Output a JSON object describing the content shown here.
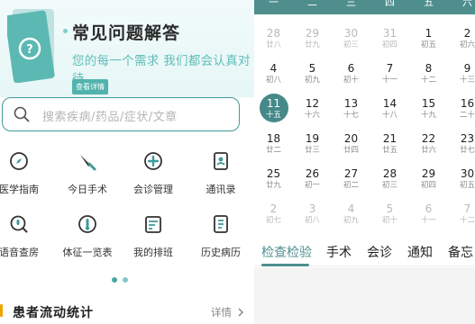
{
  "banner": {
    "title": "常见问题解答",
    "subtitle": "您的每一个需求 我们都会认真对待",
    "button": "查看详情"
  },
  "search": {
    "placeholder": "搜索疾病/药品/症状/文章"
  },
  "grid": [
    {
      "label": "医学指南",
      "icon": "compass-icon"
    },
    {
      "label": "今日手术",
      "icon": "scalpel-icon"
    },
    {
      "label": "会诊管理",
      "icon": "medical-cross-icon"
    },
    {
      "label": "通讯录",
      "icon": "contacts-icon"
    },
    {
      "label": "语音查房",
      "icon": "voice-search-icon"
    },
    {
      "label": "体征一览表",
      "icon": "thermometer-icon"
    },
    {
      "label": "我的排班",
      "icon": "schedule-icon"
    },
    {
      "label": "历史病历",
      "icon": "history-record-icon"
    }
  ],
  "pager": {
    "pages": 2,
    "active": 1
  },
  "stats": {
    "title": "患者流动统计",
    "more": "详情"
  },
  "calendar": {
    "weekdays": [
      "一",
      "二",
      "三",
      "四",
      "五",
      "六"
    ],
    "weeks": [
      [
        [
          "28",
          "廿八",
          true
        ],
        [
          "29",
          "廿九",
          true
        ],
        [
          "30",
          "初三",
          true
        ],
        [
          "31",
          "初四",
          true
        ],
        [
          "1",
          "初五",
          false
        ],
        [
          "2",
          "初六",
          false
        ]
      ],
      [
        [
          "4",
          "初八",
          false
        ],
        [
          "5",
          "初九",
          false
        ],
        [
          "6",
          "初十",
          false
        ],
        [
          "7",
          "十一",
          false
        ],
        [
          "8",
          "十二",
          false
        ],
        [
          "9",
          "十三",
          false
        ]
      ],
      [
        [
          "11",
          "十五",
          false
        ],
        [
          "12",
          "十六",
          false
        ],
        [
          "13",
          "十七",
          false
        ],
        [
          "14",
          "十八",
          false
        ],
        [
          "15",
          "十九",
          false
        ],
        [
          "16",
          "二十",
          false
        ]
      ],
      [
        [
          "18",
          "廿二",
          false
        ],
        [
          "19",
          "廿三",
          false
        ],
        [
          "20",
          "廿四",
          false
        ],
        [
          "21",
          "廿五",
          false
        ],
        [
          "22",
          "廿六",
          false
        ],
        [
          "23",
          "廿七",
          false
        ]
      ],
      [
        [
          "25",
          "廿九",
          false
        ],
        [
          "26",
          "初一",
          false
        ],
        [
          "27",
          "初二",
          false
        ],
        [
          "28",
          "初三",
          false
        ],
        [
          "29",
          "初四",
          false
        ],
        [
          "30",
          "初五",
          false
        ]
      ],
      [
        [
          "2",
          "初七",
          true
        ],
        [
          "3",
          "初八",
          true
        ],
        [
          "4",
          "初九",
          true
        ],
        [
          "5",
          "初十",
          true
        ],
        [
          "6",
          "十一",
          true
        ],
        [
          "7",
          "十二",
          true
        ]
      ]
    ],
    "selected_day": "11",
    "tabs": [
      "检查检验",
      "手术",
      "会诊",
      "通知",
      "备忘"
    ],
    "active_tab": 0
  },
  "colors": {
    "accent": "#4e8f8e",
    "teal_light": "#5fbdb6",
    "orange": "#f0a400"
  }
}
